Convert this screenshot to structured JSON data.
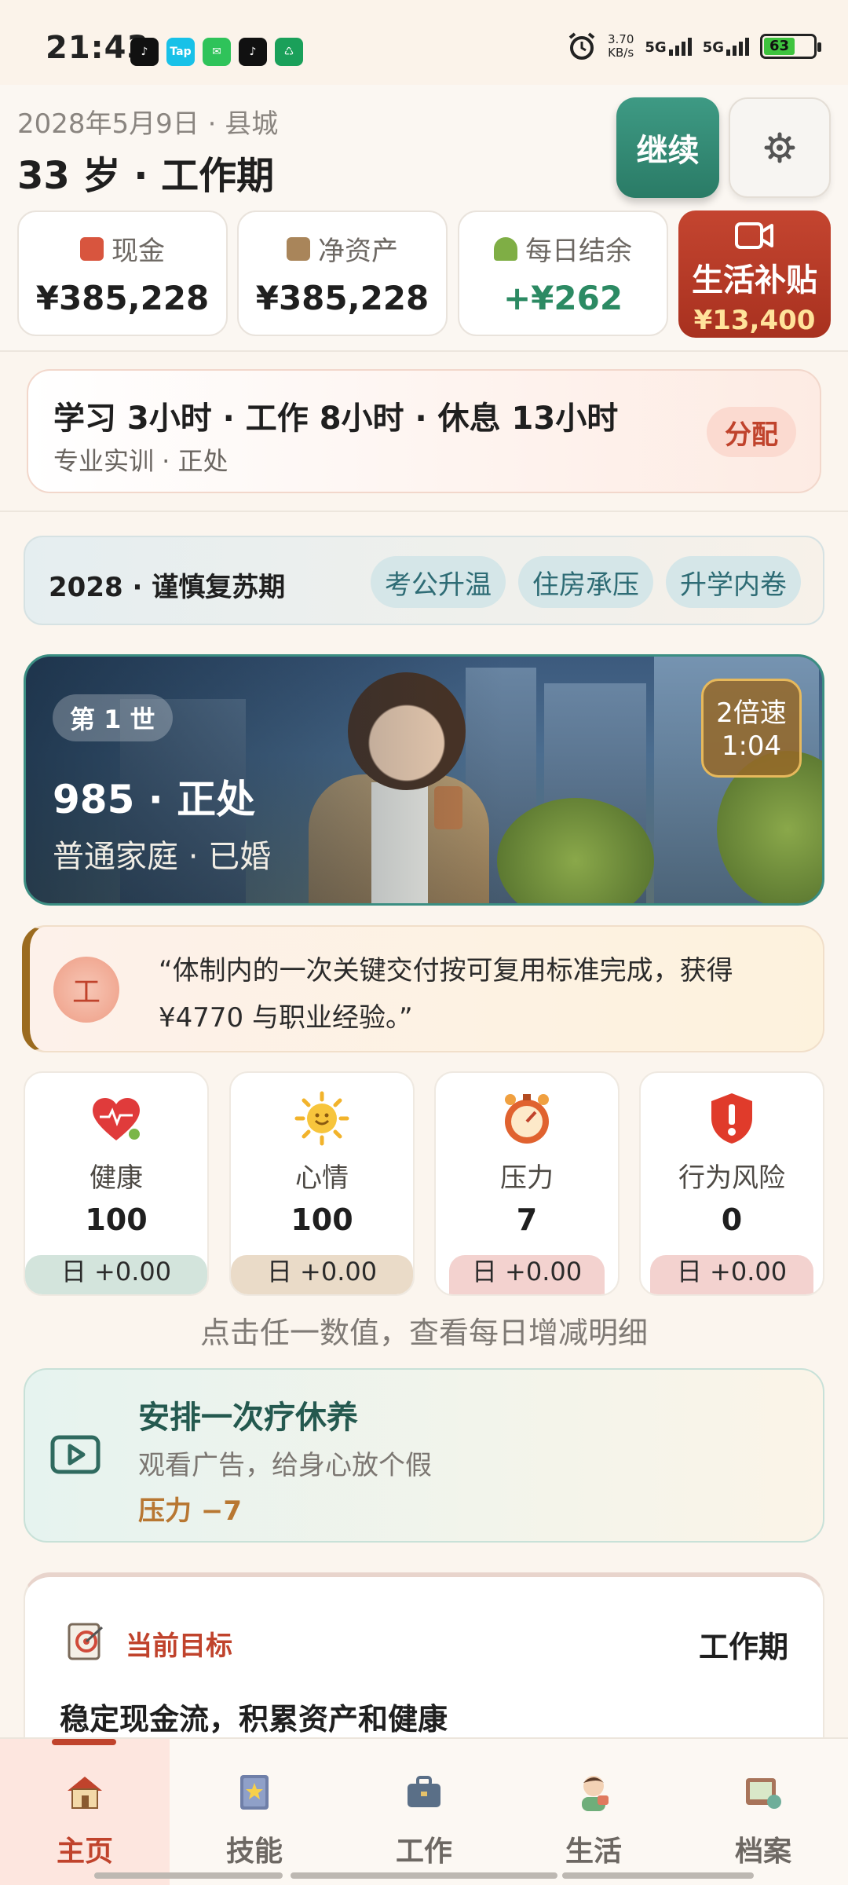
{
  "status_bar": {
    "time": "21:43",
    "apps": [
      "♪",
      "Tap",
      "✉",
      "♪",
      "♺"
    ],
    "net_speed": "3.70",
    "net_unit": "KB/s",
    "net1": "5G",
    "net2": "5G",
    "battery": "63"
  },
  "header": {
    "date_location": "2028年5月9日 · 县城",
    "age_phase": "33 岁 · 工作期",
    "continue_label": "继续"
  },
  "stats": {
    "cash_label": "现金",
    "cash_value": "¥385,228",
    "net_assets_label": "净资产",
    "net_assets_value": "¥385,228",
    "daily_label": "每日结余",
    "daily_value": "+¥262",
    "subsidy_label": "生活补贴",
    "subsidy_value": "¥13,400"
  },
  "allocation": {
    "main": "学习 3小时 · 工作 8小时 · 休息 13小时",
    "sub": "专业实训 · 正处",
    "button": "分配"
  },
  "period": {
    "title": "2028 · 谨慎复苏期",
    "tags": [
      "考公升温",
      "住房承压",
      "升学内卷"
    ]
  },
  "character": {
    "life": "第 1 世",
    "education_rank": "985 · 正处",
    "family_status": "普通家庭 · 已婚",
    "speed_label": "2倍速",
    "speed_time": "1:04"
  },
  "event": {
    "badge": "工",
    "text": "“体制内的一次关键交付按可复用标准完成，获得 ¥4770 与职业经验。”"
  },
  "attributes": [
    {
      "name": "健康",
      "value": "100",
      "delta": "日 +0.00",
      "fill": 1.0,
      "color": "#d3e4dc"
    },
    {
      "name": "心情",
      "value": "100",
      "delta": "日 +0.00",
      "fill": 1.0,
      "color": "#eadbc8"
    },
    {
      "name": "压力",
      "value": "7",
      "delta": "日 +0.00",
      "fill": 0.07,
      "color": "#f3d2cf"
    },
    {
      "name": "行为风险",
      "value": "0",
      "delta": "日 +0.00",
      "fill": 0.0,
      "color": "#f3d2cf"
    }
  ],
  "hint": "点击任一数值，查看每日增减明细",
  "rest_card": {
    "title": "安排一次疗休养",
    "desc": "观看广告，给身心放个假",
    "effect": "压力 −7"
  },
  "goal": {
    "title": "当前目标",
    "phase": "工作期",
    "desc": "稳定现金流，积累资产和健康"
  },
  "nav": [
    "主页",
    "技能",
    "工作",
    "生活",
    "档案"
  ],
  "colors": {
    "accent_red": "#c0432c",
    "accent_green": "#2c8a63",
    "continue_button": "#2a7b66"
  }
}
